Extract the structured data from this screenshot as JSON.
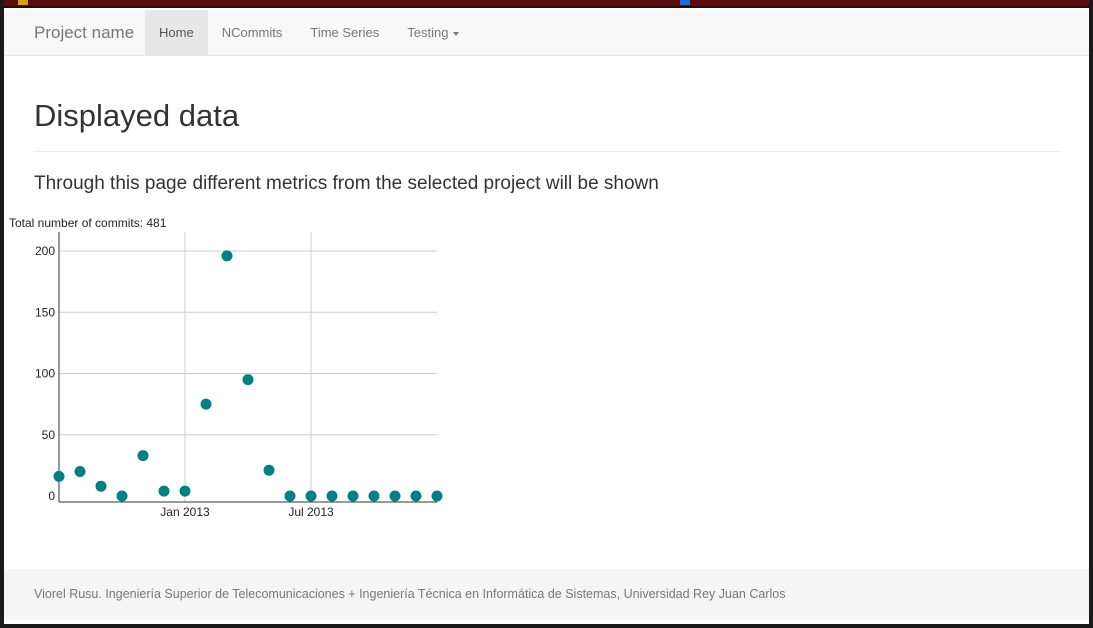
{
  "navbar": {
    "brand": "Project name",
    "items": [
      {
        "label": "Home",
        "active": true
      },
      {
        "label": "NCommits",
        "active": false
      },
      {
        "label": "Time Series",
        "active": false
      },
      {
        "label": "Testing",
        "active": false,
        "dropdown": true
      }
    ]
  },
  "main": {
    "heading": "Displayed data",
    "lead": "Through this page different metrics from the selected project will be shown"
  },
  "chart_data": {
    "type": "scatter",
    "title": "Total number of commits: 481",
    "x": [
      "2012-07",
      "2012-08",
      "2012-09",
      "2012-10",
      "2012-11",
      "2012-12",
      "2013-01",
      "2013-02",
      "2013-03",
      "2013-04",
      "2013-05",
      "2013-06",
      "2013-07",
      "2013-08",
      "2013-09",
      "2013-10",
      "2013-11",
      "2013-12",
      "2014-01"
    ],
    "values": [
      16,
      20,
      8,
      0,
      33,
      4,
      4,
      75,
      196,
      95,
      21,
      0,
      0,
      0,
      0,
      0,
      0,
      0,
      0
    ],
    "xticks": [
      "Jan 2013",
      "Jul 2013"
    ],
    "yticks": [
      0,
      50,
      100,
      150,
      200
    ],
    "ylim": [
      0,
      200
    ],
    "grid": true,
    "color": "#008080"
  },
  "footer": {
    "text": "Viorel Rusu. Ingeniería Superior de Telecomunicaciones + Ingeniería Técnica en Informática de Sistemas, Universidad Rey Juan Carlos"
  }
}
